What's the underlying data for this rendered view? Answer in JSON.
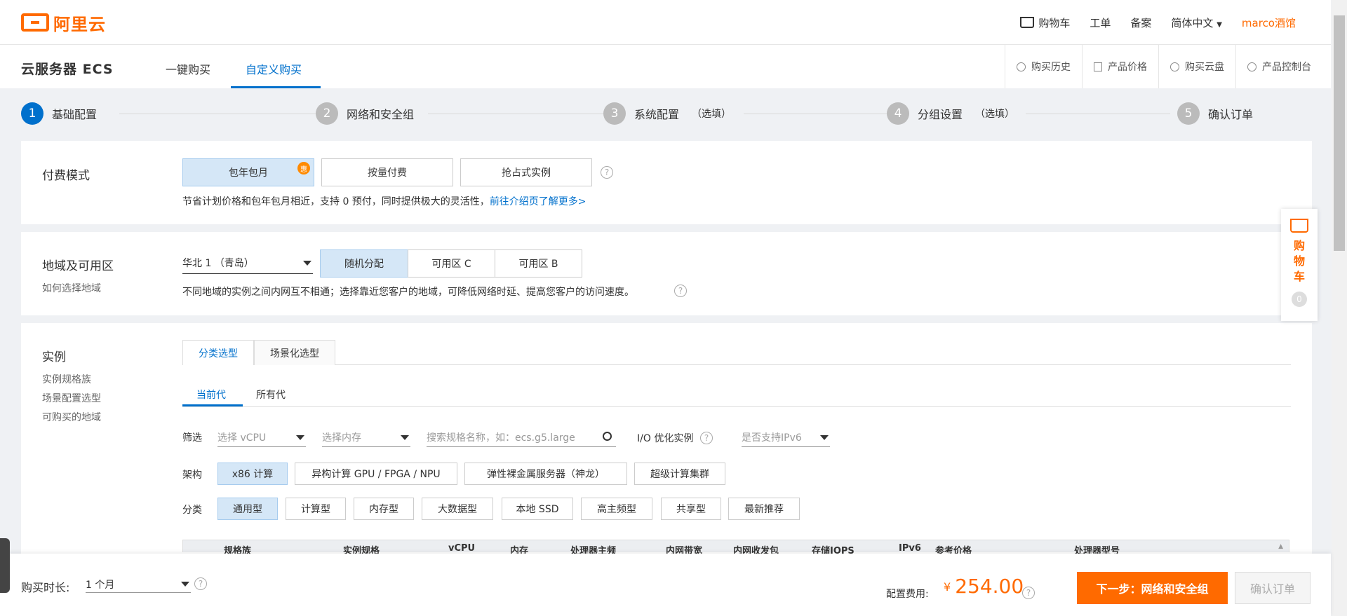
{
  "header": {
    "logo_text": "阿里云",
    "nav": {
      "cart": "购物车",
      "ticket": "工单",
      "icp": "备案",
      "lang": "简体中文",
      "user": "marco酒馆"
    }
  },
  "product": {
    "title": "云服务器 ECS",
    "tabs": [
      "一键购买",
      "自定义购买"
    ],
    "active_tab": "自定义购买",
    "links": [
      "购买历史",
      "产品价格",
      "购买云盘",
      "产品控制台"
    ]
  },
  "steps": [
    {
      "num": "1",
      "label": "基础配置",
      "optional": ""
    },
    {
      "num": "2",
      "label": "网络和安全组",
      "optional": ""
    },
    {
      "num": "3",
      "label": "系统配置",
      "optional": "（选填）"
    },
    {
      "num": "4",
      "label": "分组设置",
      "optional": "（选填）"
    },
    {
      "num": "5",
      "label": "确认订单",
      "optional": ""
    }
  ],
  "billing": {
    "label": "付费模式",
    "options": [
      "包年包月",
      "按量付费",
      "抢占式实例"
    ],
    "selected": "包年包月",
    "badge": "惠",
    "desc": "节省计划价格和包年包月相近，支持 0 预付，同时提供极大的灵活性，",
    "link": "前往介绍页了解更多>"
  },
  "region": {
    "label": "地域及可用区",
    "sub": "如何选择地域",
    "region_value": "华北 1 （青岛）",
    "zones": [
      "随机分配",
      "可用区 C",
      "可用区 B"
    ],
    "selected_zone": "随机分配",
    "desc": "不同地域的实例之间内网互不相通；选择靠近您客户的地域，可降低网络时延、提高您客户的访问速度。"
  },
  "instance": {
    "label": "实例",
    "subs": [
      "实例规格族",
      "场景配置选型",
      "可购买的地域"
    ],
    "select_tabs": [
      "分类选型",
      "场景化选型"
    ],
    "gen_tabs": [
      "当前代",
      "所有代"
    ],
    "filter": {
      "label": "筛选",
      "vcpu_placeholder": "选择 vCPU",
      "mem_placeholder": "选择内存",
      "search_placeholder": "搜索规格名称，如：ecs.g5.large",
      "io_label": "I/O 优化实例",
      "ipv6_placeholder": "是否支持IPv6"
    },
    "arch": {
      "label": "架构",
      "options": [
        "x86 计算",
        "异构计算 GPU / FPGA / NPU",
        "弹性裸金属服务器（神龙）",
        "超级计算集群"
      ]
    },
    "category": {
      "label": "分类",
      "options": [
        "通用型",
        "计算型",
        "内存型",
        "大数据型",
        "本地 SSD",
        "高主频型",
        "共享型",
        "最新推荐"
      ]
    },
    "table_headers": [
      "规格族",
      "实例规格",
      "vCPU",
      "内存",
      "处理器主频",
      "内网带宽",
      "内网收发包",
      "存储IOPS",
      "IPv6",
      "参考价格",
      "处理器型号"
    ]
  },
  "cart_float": {
    "text": "购物车",
    "count": "0"
  },
  "footer": {
    "duration_label": "购买时长:",
    "duration_value": "1 个月",
    "cost_label": "配置费用:",
    "currency": "¥",
    "cost": "254.00",
    "next_button": "下一步：网络和安全组",
    "confirm_button": "确认订单"
  },
  "colors": {
    "accent": "#0070cc",
    "brand": "#ff6a00"
  }
}
